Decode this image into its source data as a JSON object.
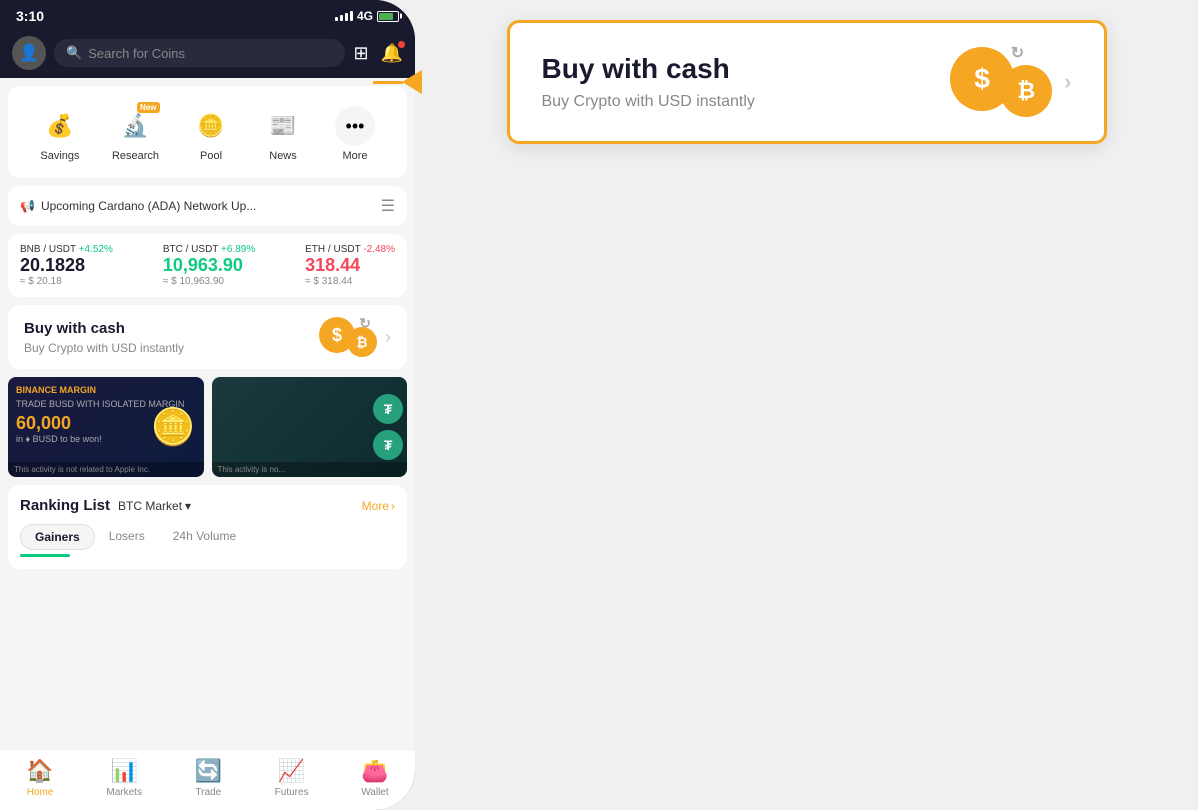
{
  "statusBar": {
    "time": "3:10",
    "network": "4G"
  },
  "topBar": {
    "searchPlaceholder": "Search for Coins"
  },
  "quickAccess": {
    "items": [
      {
        "id": "savings",
        "label": "Savings",
        "icon": "💰",
        "new": false
      },
      {
        "id": "research",
        "label": "Research",
        "icon": "🔬",
        "new": true
      },
      {
        "id": "pool",
        "label": "Pool",
        "icon": "🪙",
        "new": false
      },
      {
        "id": "news",
        "label": "News",
        "icon": "📰",
        "new": false
      },
      {
        "id": "more",
        "label": "More",
        "icon": "⋯",
        "new": false
      }
    ]
  },
  "announcement": {
    "text": "Upcoming Cardano (ADA) Network Up..."
  },
  "prices": [
    {
      "pair": "BNB / USDT",
      "change": "+4.52%",
      "positive": true,
      "value": "20.1828",
      "usd": "≈ $ 20.18"
    },
    {
      "pair": "BTC / USDT",
      "change": "+6.89%",
      "positive": true,
      "value": "10,963.90",
      "usd": "≈ $ 10,963.90"
    },
    {
      "pair": "ETH / USDT",
      "change": "-2.48%",
      "positive": false,
      "value": "318.44",
      "usd": "≈ $ 318.44"
    }
  ],
  "buyCash": {
    "title": "Buy with cash",
    "subtitle": "Buy Crypto with USD instantly"
  },
  "banners": [
    {
      "id": "margin",
      "logo": "BINANCE MARGIN",
      "promo": "TRADE BUSD WITH ISOLATED MARGIN",
      "amount": "60,000",
      "currency": "in BUSD to be won!",
      "disclaimer": "This activity is not related to Apple Inc."
    },
    {
      "id": "tether",
      "disclaimer": "This activity is no..."
    }
  ],
  "ranking": {
    "title": "Ranking List",
    "market": "BTC Market",
    "moreLabel": "More",
    "tabs": [
      {
        "label": "Gainers",
        "active": true
      },
      {
        "label": "Losers",
        "active": false
      },
      {
        "label": "24h Volume",
        "active": false
      }
    ]
  },
  "bottomNav": {
    "items": [
      {
        "id": "home",
        "label": "Home",
        "icon": "🏠",
        "active": true
      },
      {
        "id": "markets",
        "label": "Markets",
        "icon": "📊",
        "active": false
      },
      {
        "id": "trade",
        "label": "Trade",
        "icon": "🔄",
        "active": false
      },
      {
        "id": "futures",
        "label": "Futures",
        "icon": "📈",
        "active": false
      },
      {
        "id": "wallet",
        "label": "Wallet",
        "icon": "👛",
        "active": false
      }
    ]
  },
  "popup": {
    "title": "Buy with cash",
    "subtitle": "Buy Crypto with USD instantly"
  }
}
